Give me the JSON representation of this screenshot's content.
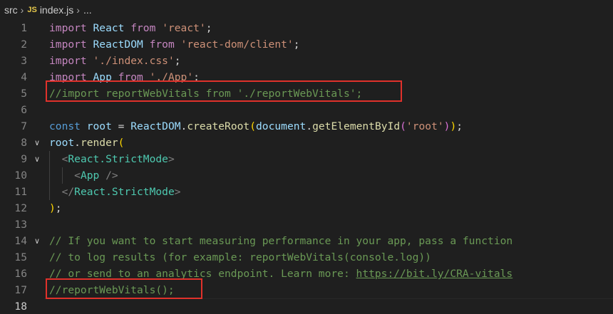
{
  "breadcrumb": {
    "folder": "src",
    "file_icon": "JS",
    "file": "index.js",
    "more": "..."
  },
  "editor": {
    "current_line": 18,
    "highlight_color": "#e0312b",
    "lines": [
      {
        "n": "1",
        "fold": "",
        "tokens": [
          {
            "t": "import",
            "c": "kw"
          },
          {
            "t": " React ",
            "c": "var"
          },
          {
            "t": "from",
            "c": "kw"
          },
          {
            "t": " ",
            "c": "p"
          },
          {
            "t": "'react'",
            "c": "str"
          },
          {
            "t": ";",
            "c": "p"
          }
        ]
      },
      {
        "n": "2",
        "fold": "",
        "tokens": [
          {
            "t": "import",
            "c": "kw"
          },
          {
            "t": " ReactDOM ",
            "c": "var"
          },
          {
            "t": "from",
            "c": "kw"
          },
          {
            "t": " ",
            "c": "p"
          },
          {
            "t": "'react-dom/client'",
            "c": "str"
          },
          {
            "t": ";",
            "c": "p"
          }
        ]
      },
      {
        "n": "3",
        "fold": "",
        "tokens": [
          {
            "t": "import",
            "c": "kw"
          },
          {
            "t": " ",
            "c": "p"
          },
          {
            "t": "'./index.css'",
            "c": "str"
          },
          {
            "t": ";",
            "c": "p"
          }
        ]
      },
      {
        "n": "4",
        "fold": "",
        "tokens": [
          {
            "t": "import",
            "c": "kw"
          },
          {
            "t": " App ",
            "c": "var"
          },
          {
            "t": "from",
            "c": "kw"
          },
          {
            "t": " ",
            "c": "p"
          },
          {
            "t": "'./App'",
            "c": "str"
          },
          {
            "t": ";",
            "c": "p"
          }
        ]
      },
      {
        "n": "5",
        "fold": "",
        "tokens": [
          {
            "t": "//import reportWebVitals from './reportWebVitals';",
            "c": "cm"
          }
        ]
      },
      {
        "n": "6",
        "fold": "",
        "tokens": []
      },
      {
        "n": "7",
        "fold": "",
        "tokens": [
          {
            "t": "const",
            "c": "kw2"
          },
          {
            "t": " ",
            "c": "p"
          },
          {
            "t": "root",
            "c": "var"
          },
          {
            "t": " = ",
            "c": "p"
          },
          {
            "t": "ReactDOM",
            "c": "var"
          },
          {
            "t": ".",
            "c": "p"
          },
          {
            "t": "createRoot",
            "c": "fn"
          },
          {
            "t": "(",
            "c": "b1"
          },
          {
            "t": "document",
            "c": "var"
          },
          {
            "t": ".",
            "c": "p"
          },
          {
            "t": "getElementById",
            "c": "fn"
          },
          {
            "t": "(",
            "c": "b2"
          },
          {
            "t": "'root'",
            "c": "str"
          },
          {
            "t": ")",
            "c": "b2"
          },
          {
            "t": ")",
            "c": "b1"
          },
          {
            "t": ";",
            "c": "p"
          }
        ]
      },
      {
        "n": "8",
        "fold": "∨",
        "tokens": [
          {
            "t": "root",
            "c": "var"
          },
          {
            "t": ".",
            "c": "p"
          },
          {
            "t": "render",
            "c": "fn"
          },
          {
            "t": "(",
            "c": "b1"
          }
        ]
      },
      {
        "n": "9",
        "fold": "∨",
        "tokens": [
          {
            "t": "  ",
            "c": "p"
          },
          {
            "t": "<",
            "c": "tagb"
          },
          {
            "t": "React.StrictMode",
            "c": "cls"
          },
          {
            "t": ">",
            "c": "tagb"
          }
        ]
      },
      {
        "n": "10",
        "fold": "",
        "tokens": [
          {
            "t": "    ",
            "c": "p"
          },
          {
            "t": "<",
            "c": "tagb"
          },
          {
            "t": "App",
            "c": "cls"
          },
          {
            "t": " />",
            "c": "tagb"
          }
        ]
      },
      {
        "n": "11",
        "fold": "",
        "tokens": [
          {
            "t": "  ",
            "c": "p"
          },
          {
            "t": "</",
            "c": "tagb"
          },
          {
            "t": "React.StrictMode",
            "c": "cls"
          },
          {
            "t": ">",
            "c": "tagb"
          }
        ]
      },
      {
        "n": "12",
        "fold": "",
        "tokens": [
          {
            "t": ")",
            "c": "b1"
          },
          {
            "t": ";",
            "c": "p"
          }
        ]
      },
      {
        "n": "13",
        "fold": "",
        "tokens": []
      },
      {
        "n": "14",
        "fold": "∨",
        "tokens": [
          {
            "t": "// If you want to start measuring performance in your app, pass a function",
            "c": "cm"
          }
        ]
      },
      {
        "n": "15",
        "fold": "",
        "tokens": [
          {
            "t": "// to log results (for example: reportWebVitals(console.log))",
            "c": "cm"
          }
        ]
      },
      {
        "n": "16",
        "fold": "",
        "tokens": [
          {
            "t": "// or send to an analytics endpoint. Learn more: ",
            "c": "cm"
          },
          {
            "t": "https://bit.ly/CRA-vitals",
            "c": "link"
          }
        ]
      },
      {
        "n": "17",
        "fold": "",
        "tokens": [
          {
            "t": "//reportWebVitals();",
            "c": "cm"
          }
        ]
      },
      {
        "n": "18",
        "fold": "",
        "tokens": []
      }
    ]
  }
}
